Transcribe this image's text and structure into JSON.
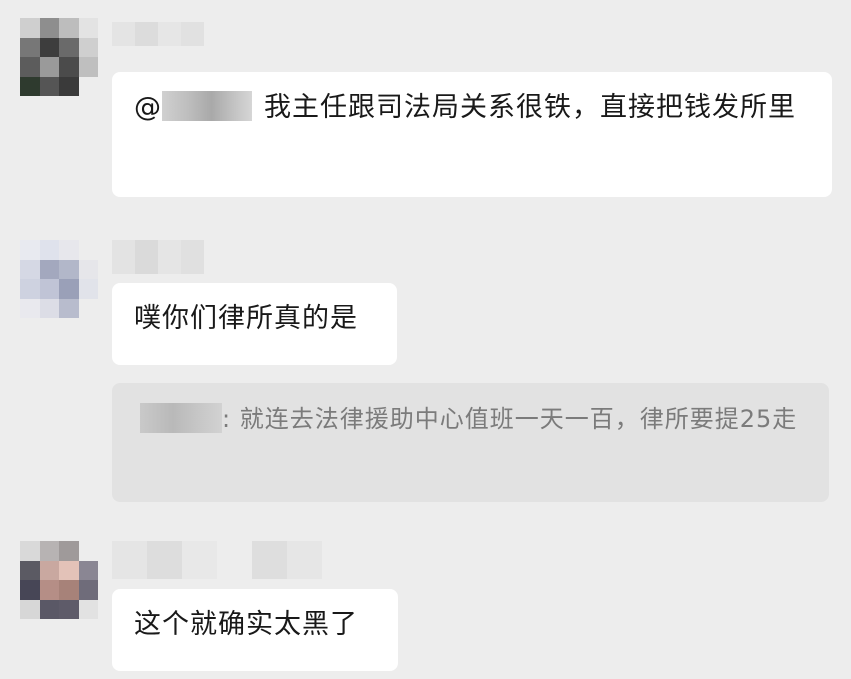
{
  "chat": {
    "messages": [
      {
        "mention_prefix": "@",
        "text": "我主任跟司法局关系很铁，直接把钱发所里"
      },
      {
        "text": "噗你们律所真的是"
      },
      {
        "quote_separator": ":",
        "quote_text": "就连去法律援助中心值班一天一百，律所要提25走"
      },
      {
        "text": "这个就确实太黑了"
      }
    ]
  },
  "colors": {
    "background": "#ededed",
    "bubble": "#ffffff",
    "quote_background": "#e2e2e2",
    "quote_text": "#7b7b7b",
    "message_text": "#191919"
  }
}
